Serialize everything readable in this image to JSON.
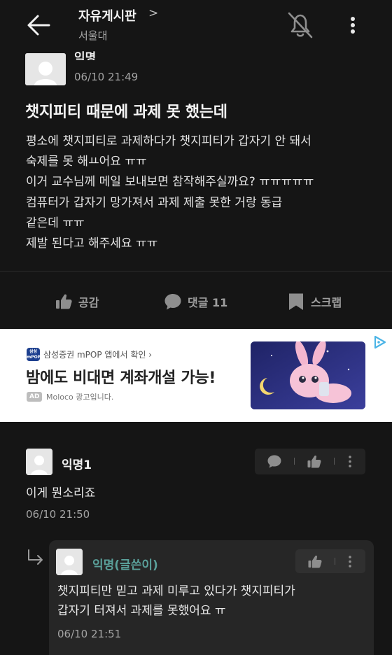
{
  "header": {
    "board_title": "자유게시판",
    "board_chevron": ">",
    "school": "서울대",
    "icons": [
      "back-arrow-icon",
      "notification-off-icon",
      "more-vertical-icon"
    ]
  },
  "post": {
    "author": "익명",
    "time": "06/10 21:49",
    "title": "챗지피티 때문에 과제 못 했는데",
    "body_lines": [
      "평소에 챗지피티로 과제하다가 챗지피티가 갑자기 안 돼서",
      "숙제를 못 해ㅛ어요 ㅠㅠ",
      "이거 교수님께 메일 보내보면 참작해주실까요? ㅠㅠㅠㅠㅠ",
      "컴퓨터가 갑자기 망가져서 과제 제출 못한 거랑 동급",
      "같은데 ㅠㅠ",
      "제발 된다고 해주세요 ㅠㅠ"
    ],
    "actions": {
      "like_label": "공감",
      "comment_label": "댓글 11",
      "scrap_label": "스크랩"
    }
  },
  "ad": {
    "app_icon_text": "삼성증권 mPOP",
    "sponsor": "삼성증권 mPOP 앱에서 확인 ›",
    "headline": "밤에도 비대면 계좌개설 가능!",
    "badge": "AD",
    "by": "Moloco 광고입니다."
  },
  "comments": [
    {
      "author": "익명1",
      "text": "이게 뭔소리죠",
      "time": "06/10 21:50"
    }
  ],
  "reply": {
    "author": "익명(글쓴이)",
    "text_lines": [
      "챗지피티만 믿고 과제 미루고 있다가 챗지피티가",
      "갑자기 터져서 과제를 못했어요 ㅠ"
    ],
    "time": "06/10 21:51"
  },
  "colors": {
    "background": "#151515",
    "author_highlight": "#5aa09a",
    "muted": "#a4a4a4"
  }
}
